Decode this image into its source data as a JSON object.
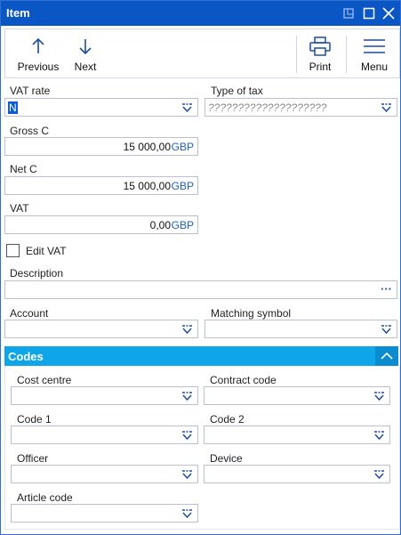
{
  "window": {
    "title": "Item"
  },
  "toolbar": {
    "previous_label": "Previous",
    "next_label": "Next",
    "print_label": "Print",
    "menu_label": "Menu"
  },
  "form": {
    "vat_rate": {
      "label": "VAT rate",
      "value": "N"
    },
    "type_of_tax": {
      "label": "Type of tax",
      "placeholder": "????????????????????"
    },
    "gross_c": {
      "label": "Gross C",
      "value": "15 000,00",
      "currency": "GBP"
    },
    "net_c": {
      "label": "Net C",
      "value": "15 000,00",
      "currency": "GBP"
    },
    "vat": {
      "label": "VAT",
      "value": "0,00",
      "currency": "GBP"
    },
    "edit_vat": {
      "label": "Edit VAT",
      "checked": false
    },
    "description": {
      "label": "Description",
      "value": "",
      "ellipsis": "···"
    },
    "account": {
      "label": "Account",
      "value": ""
    },
    "matching_symbol": {
      "label": "Matching symbol",
      "value": ""
    }
  },
  "codes": {
    "title": "Codes",
    "cost_centre": {
      "label": "Cost centre",
      "value": ""
    },
    "contract_code": {
      "label": "Contract code",
      "value": ""
    },
    "code_1": {
      "label": "Code 1",
      "value": ""
    },
    "code_2": {
      "label": "Code 2",
      "value": ""
    },
    "officer": {
      "label": "Officer",
      "value": ""
    },
    "device": {
      "label": "Device",
      "value": ""
    },
    "article_code": {
      "label": "Article code",
      "value": ""
    }
  },
  "colors": {
    "titlebar": "#0a56c5",
    "section_header": "#0ea6e8",
    "currency": "#1e5fbf",
    "accent": "#0b5bd3"
  },
  "icons": [
    "restore-icon",
    "maximize-icon",
    "close-icon",
    "arrow-up-icon",
    "arrow-down-icon",
    "printer-icon",
    "hamburger-menu-icon",
    "dropdown-icon",
    "ellipsis-icon",
    "chevron-up-icon"
  ]
}
